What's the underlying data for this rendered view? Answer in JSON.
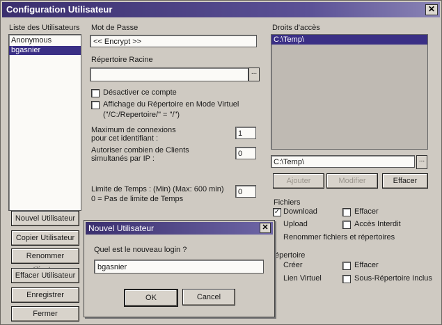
{
  "window": {
    "title": "Configuration Utilisateur",
    "close": "✕"
  },
  "users": {
    "label": "Liste des Utilisateurs",
    "items": [
      "Anonymous",
      "bgasnier"
    ]
  },
  "password": {
    "label": "Mot de Passe",
    "value": "<< Encrypt >>"
  },
  "root_dir": {
    "label": "Répertoire Racine",
    "value": ""
  },
  "options": {
    "disable_account": "Désactiver ce compte",
    "virtual_mode": "Affichage du Répertoire en Mode Virtuel",
    "virtual_mode_hint": "(\"/C:/Repertoire/\" = \"/\")"
  },
  "max_connections": {
    "label_line1": "Maximum de connexions",
    "label_line2": "pour cet identifiant :",
    "value": "1"
  },
  "clients_per_ip": {
    "label_line1": "Autoriser combien de Clients",
    "label_line2": "simultanés par IP :",
    "value": "0"
  },
  "time_limit": {
    "label_line1": "Limite de Temps : (Min) (Max: 600 min)",
    "label_line2": "0 = Pas de limite de Temps",
    "value": "0"
  },
  "left_buttons": [
    "Nouvel Utilisateur",
    "Copier Utilisateur",
    "Renommer utilisateur",
    "Effacer Utilisateur",
    "Enregistrer",
    "Fermer"
  ],
  "access": {
    "label": "Droits d'accès",
    "items": [
      "C:\\Temp\\"
    ],
    "path_value": "C:\\Temp\\",
    "add": "Ajouter",
    "modify": "Modifier",
    "delete": "Effacer"
  },
  "files": {
    "label": "Fichiers",
    "download": "Download",
    "upload": "Upload",
    "rename": "Renommer fichiers et répertoires",
    "delete": "Effacer",
    "forbidden": "Accès Interdit"
  },
  "directory": {
    "label": "épertoire",
    "create": "Créer",
    "virtual_link": "Lien Virtuel",
    "delete": "Effacer",
    "subdir": "Sous-Répertoire Inclus"
  },
  "new_user_dialog": {
    "title": "Nouvel Utilisateur",
    "close": "✕",
    "prompt": "Quel est le nouveau login ?",
    "value": "bgasnier",
    "ok": "OK",
    "cancel": "Cancel"
  }
}
